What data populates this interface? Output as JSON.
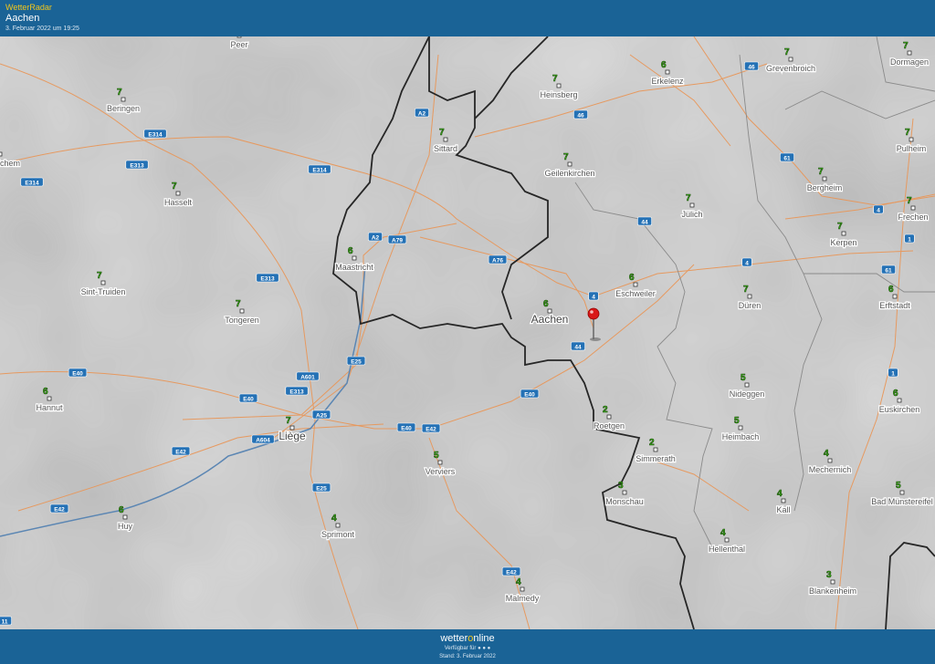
{
  "header": {
    "app_title": "WetterRadar",
    "location": "Aachen",
    "timestamp": "3. Februar 2022 um 19:25"
  },
  "footer": {
    "brand_prefix": "wetter",
    "brand_o": "o",
    "brand_suffix": "nline",
    "available": "Verfügbar für",
    "stand": "Stand: 3. Februar 2022"
  },
  "colors": {
    "bar": "#1a6396",
    "accent": "#f2c61b",
    "road": "#e8975a",
    "border": "#262626",
    "river": "#5b86b3",
    "temp": "#3cb317"
  },
  "map": {
    "marker": "red-pin",
    "places": [
      {
        "name": "Peer",
        "temp": ""
      },
      {
        "name": "Beringen",
        "temp": "7"
      },
      {
        "name": "vel-Zichem",
        "temp": "7"
      },
      {
        "name": "Hasselt",
        "temp": "7"
      },
      {
        "name": "Sint-Truiden",
        "temp": "7"
      },
      {
        "name": "Tongeren",
        "temp": "7"
      },
      {
        "name": "Hannut",
        "temp": "6"
      },
      {
        "name": "Huy",
        "temp": "6"
      },
      {
        "name": "Liège",
        "temp": "7"
      },
      {
        "name": "Maastricht",
        "temp": "6"
      },
      {
        "name": "Sittard",
        "temp": "7"
      },
      {
        "name": "Heinsberg",
        "temp": "7"
      },
      {
        "name": "Geilenkirchen",
        "temp": "7"
      },
      {
        "name": "Erkelenz",
        "temp": "6"
      },
      {
        "name": "Grevenbroich",
        "temp": "7"
      },
      {
        "name": "Dormagen",
        "temp": "7"
      },
      {
        "name": "Pulheim",
        "temp": "7"
      },
      {
        "name": "Bergheim",
        "temp": "7"
      },
      {
        "name": "Jülich",
        "temp": "7"
      },
      {
        "name": "Frechen",
        "temp": "7"
      },
      {
        "name": "Kerpen",
        "temp": "7"
      },
      {
        "name": "Eschweiler",
        "temp": "6"
      },
      {
        "name": "Aachen",
        "temp": "6"
      },
      {
        "name": "Düren",
        "temp": "7"
      },
      {
        "name": "Erftstadt",
        "temp": "6"
      },
      {
        "name": "Verviers",
        "temp": "5"
      },
      {
        "name": "Roetgen",
        "temp": "2"
      },
      {
        "name": "Simmerath",
        "temp": "2"
      },
      {
        "name": "Monschau",
        "temp": "3"
      },
      {
        "name": "Nideggen",
        "temp": "5"
      },
      {
        "name": "Heimbach",
        "temp": "5"
      },
      {
        "name": "Euskirchen",
        "temp": "6"
      },
      {
        "name": "Mechernich",
        "temp": "4"
      },
      {
        "name": "Kall",
        "temp": "4"
      },
      {
        "name": "Bad Münstereifel",
        "temp": "5"
      },
      {
        "name": "Sprimont",
        "temp": "4"
      },
      {
        "name": "Hellenthal",
        "temp": "4"
      },
      {
        "name": "Blankenheim",
        "temp": "3"
      },
      {
        "name": "Malmedy",
        "temp": "4"
      }
    ],
    "road_labels": [
      "E314",
      "E313",
      "E314",
      "E314",
      "A2",
      "A2",
      "A79",
      "A76",
      "E313",
      "E40",
      "E40",
      "A601",
      "E313",
      "E25",
      "A25",
      "A604",
      "E42",
      "E40",
      "E42",
      "E42",
      "E25",
      "E40",
      "E42",
      "46",
      "46",
      "61",
      "61",
      "44",
      "4",
      "4",
      "4",
      "44",
      "1",
      "1",
      "11"
    ]
  }
}
